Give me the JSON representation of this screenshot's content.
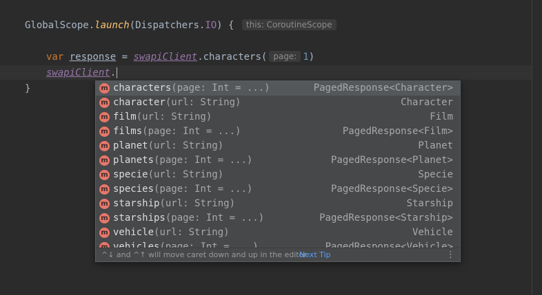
{
  "code": {
    "line1": {
      "receiver": "GlobalScope.",
      "fn": "launch",
      "open": "(Dispatchers.",
      "io": "IO",
      "close": ") {",
      "hint": "this: CoroutineScope"
    },
    "line2": {
      "kw": "var",
      "var_name": "response",
      "assign": " = ",
      "client": "swapiClient",
      "call": ".characters(",
      "hint": "page:",
      "arg": "1",
      "close": ")"
    },
    "line3": {
      "client": "swapiClient",
      "dot": "."
    },
    "line4": {
      "brace": "}"
    }
  },
  "completion": {
    "icon_letter": "m",
    "items": [
      {
        "name": "characters",
        "params": "(page: Int = ...)",
        "type": "PagedResponse<Character>"
      },
      {
        "name": "character",
        "params": "(url: String)",
        "type": "Character"
      },
      {
        "name": "film",
        "params": "(url: String)",
        "type": "Film"
      },
      {
        "name": "films",
        "params": "(page: Int = ...)",
        "type": "PagedResponse<Film>"
      },
      {
        "name": "planet",
        "params": "(url: String)",
        "type": "Planet"
      },
      {
        "name": "planets",
        "params": "(page: Int = ...)",
        "type": "PagedResponse<Planet>"
      },
      {
        "name": "specie",
        "params": "(url: String)",
        "type": "Specie"
      },
      {
        "name": "species",
        "params": "(page: Int = ...)",
        "type": "PagedResponse<Specie>"
      },
      {
        "name": "starship",
        "params": "(url: String)",
        "type": "Starship"
      },
      {
        "name": "starships",
        "params": "(page: Int = ...)",
        "type": "PagedResponse<Starship>"
      },
      {
        "name": "vehicle",
        "params": "(url: String)",
        "type": "Vehicle"
      },
      {
        "name": "vehicles",
        "params": "(page: Int = ...)",
        "type": "PagedResponse<Vehicle>"
      }
    ],
    "footer": {
      "text": "^↓ and ^↑ will move caret down and up in the editor",
      "link": "Next Tip"
    }
  },
  "colors": {
    "background": "#2b2b2b",
    "popup": "#46484a",
    "selected_row": "#55585a",
    "method_icon": "#e8776a",
    "link": "#589df6"
  }
}
